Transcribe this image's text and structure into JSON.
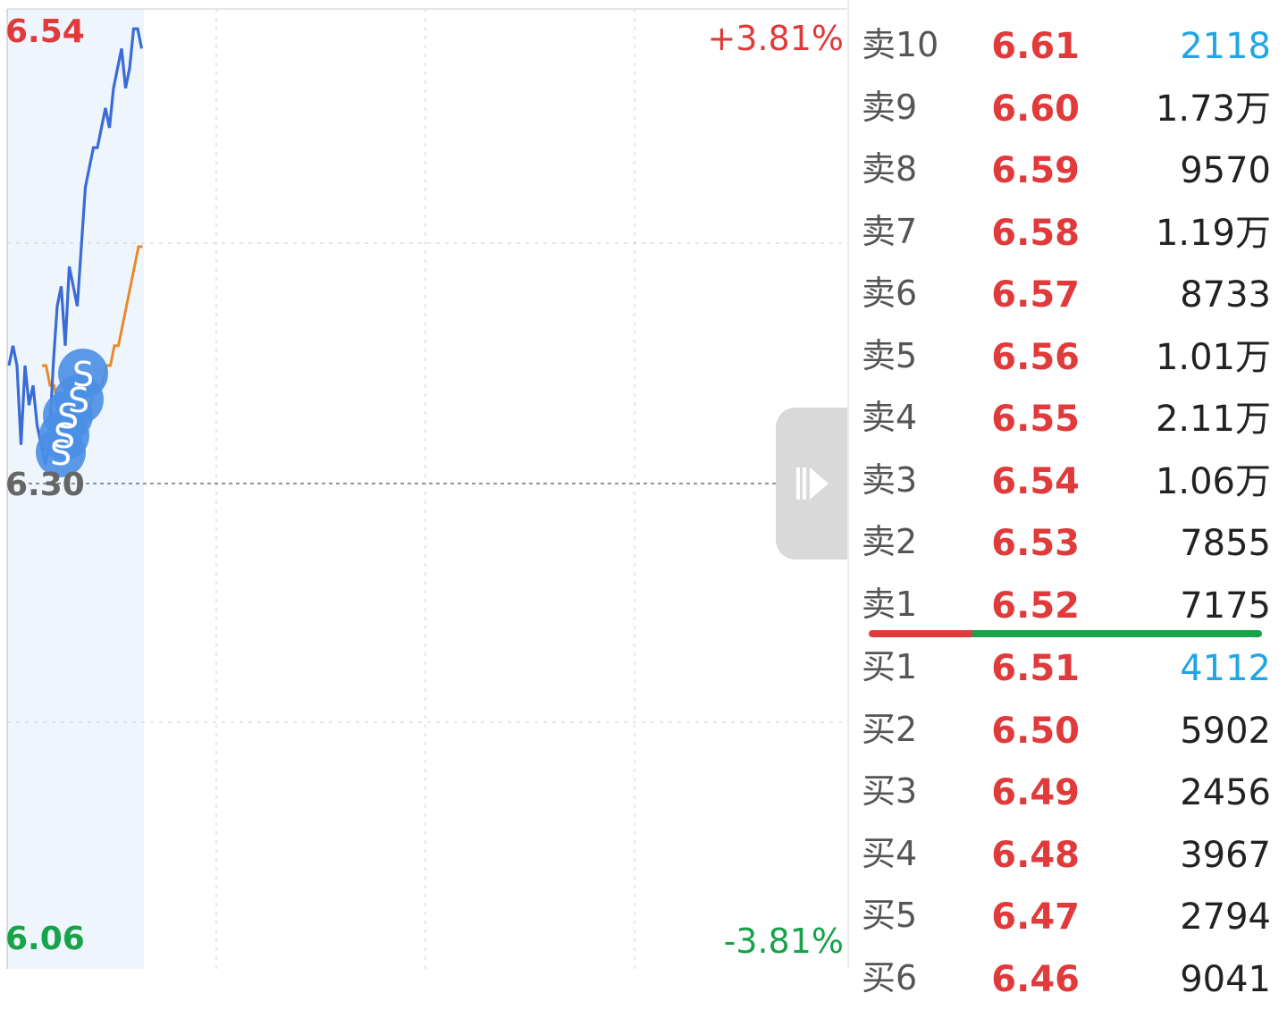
{
  "chart": {
    "high_price": "6.54",
    "prev_close": "6.30",
    "low_price": "6.06",
    "high_pct": "+3.81%",
    "low_pct": "-3.81%",
    "colors": {
      "up": "#e03a3a",
      "down": "#17a34a",
      "price_line": "#3a6bd6",
      "avg_line": "#e8892a"
    },
    "marker_icon": "s-marker-icon",
    "collapse_icon": "collapse-arrow-icon"
  },
  "chart_data": {
    "type": "line",
    "xlabel": "",
    "ylabel": "",
    "ylim": [
      6.06,
      6.54
    ],
    "series": [
      {
        "values": [
          6.36,
          6.37,
          6.36,
          6.32,
          6.36,
          6.34,
          6.35,
          6.33,
          6.32,
          6.31,
          6.32,
          6.36,
          6.39,
          6.4,
          6.37,
          6.41,
          6.4,
          6.39,
          6.42,
          6.45,
          6.46,
          6.47,
          6.47,
          6.48,
          6.49,
          6.48,
          6.5,
          6.51,
          6.52,
          6.5,
          6.51,
          6.53,
          6.53,
          6.52
        ]
      },
      {
        "values": [
          6.36,
          6.36,
          6.35,
          6.35,
          6.34,
          6.34,
          6.34,
          6.33,
          6.33,
          6.33,
          6.33,
          6.34,
          6.34,
          6.35,
          6.35,
          6.35,
          6.36,
          6.36,
          6.37,
          6.37,
          6.38,
          6.39,
          6.4,
          6.41,
          6.42,
          6.42
        ]
      }
    ]
  },
  "orderbook": {
    "asks": [
      {
        "label": "卖10",
        "price": "6.61",
        "volume": "2118"
      },
      {
        "label": "卖9",
        "price": "6.60",
        "volume": "1.73万"
      },
      {
        "label": "卖8",
        "price": "6.59",
        "volume": "9570"
      },
      {
        "label": "卖7",
        "price": "6.58",
        "volume": "1.19万"
      },
      {
        "label": "卖6",
        "price": "6.57",
        "volume": "8733"
      },
      {
        "label": "卖5",
        "price": "6.56",
        "volume": "1.01万"
      },
      {
        "label": "卖4",
        "price": "6.55",
        "volume": "2.11万"
      },
      {
        "label": "卖3",
        "price": "6.54",
        "volume": "1.06万"
      },
      {
        "label": "卖2",
        "price": "6.53",
        "volume": "7855"
      },
      {
        "label": "卖1",
        "price": "6.52",
        "volume": "7175"
      }
    ],
    "bids": [
      {
        "label": "买1",
        "price": "6.51",
        "volume": "4112"
      },
      {
        "label": "买2",
        "price": "6.50",
        "volume": "5902"
      },
      {
        "label": "买3",
        "price": "6.49",
        "volume": "2456"
      },
      {
        "label": "买4",
        "price": "6.48",
        "volume": "3967"
      },
      {
        "label": "买5",
        "price": "6.47",
        "volume": "2794"
      },
      {
        "label": "买6",
        "price": "6.46",
        "volume": "9041"
      }
    ],
    "colors": {
      "price": "#e03a3a",
      "highlight_volume": "#21a5e4",
      "balance_red": "#e03a3a",
      "balance_green": "#16a34a"
    }
  }
}
